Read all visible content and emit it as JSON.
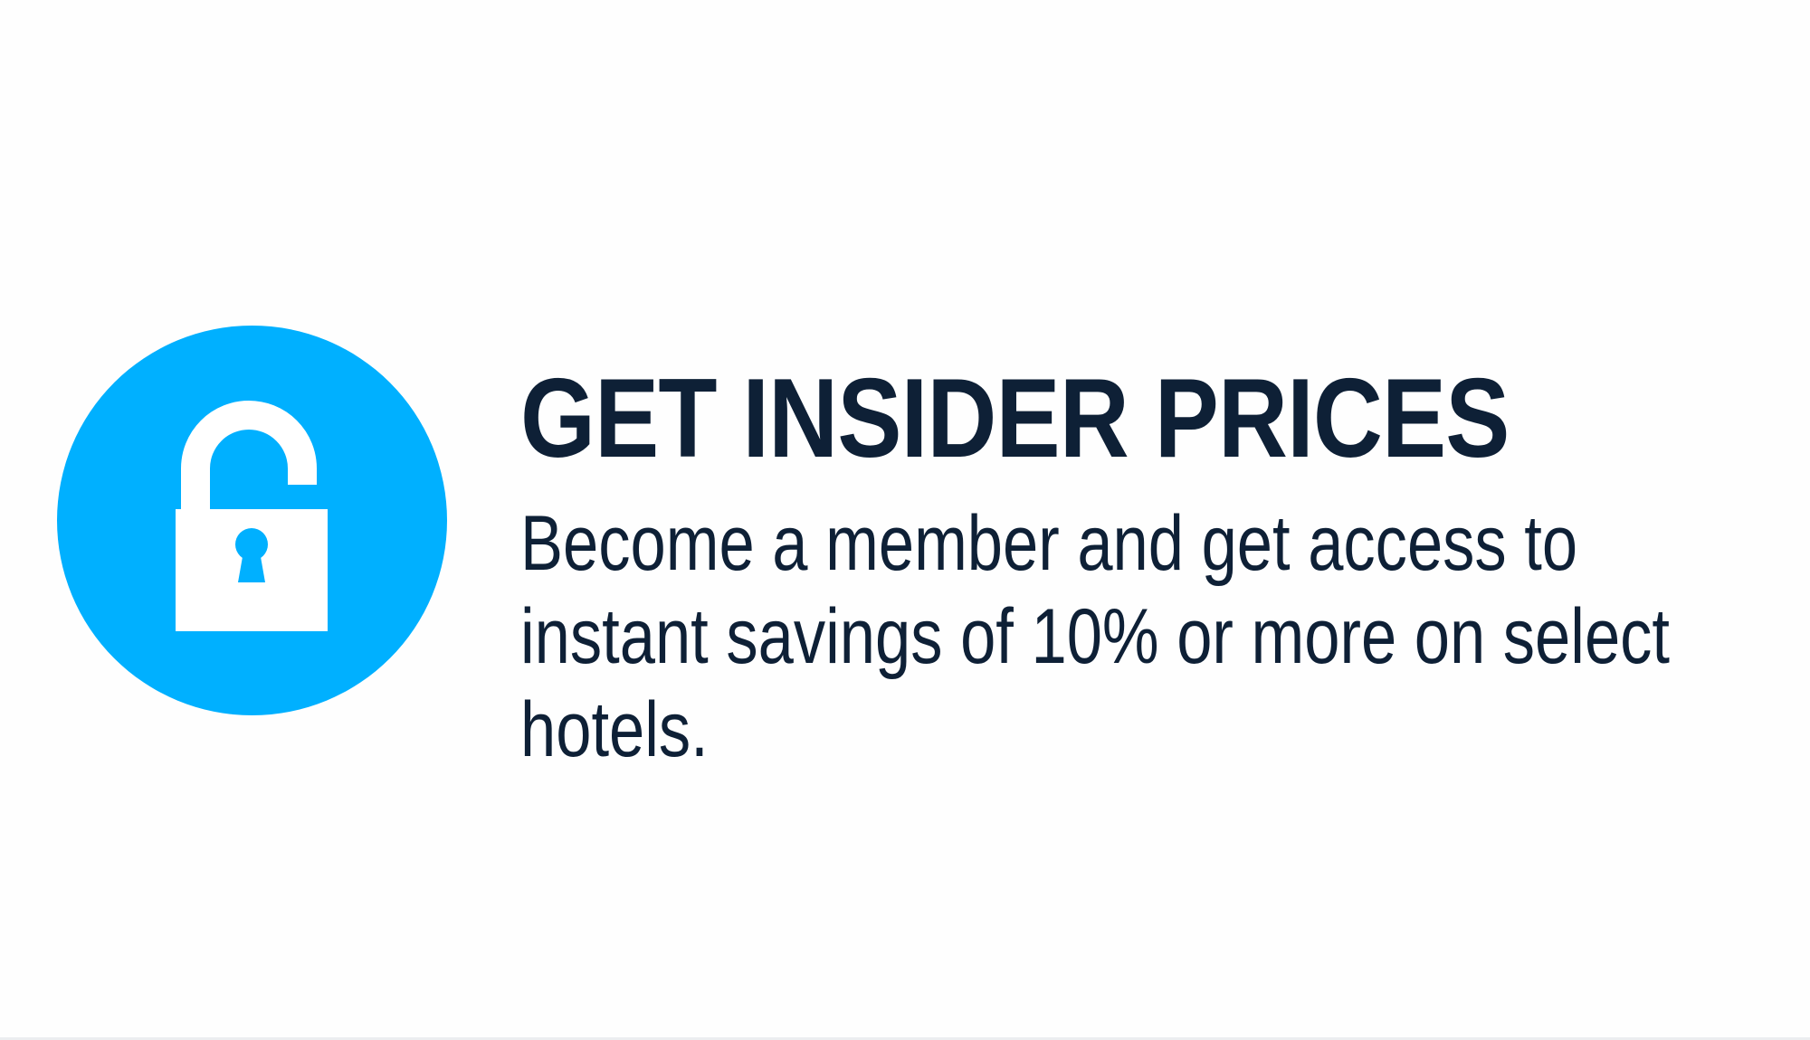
{
  "promo": {
    "headline": "GET INSIDER PRICES",
    "body": "Become a member and get access to instant savings of 10% or more on select hotels.",
    "icon": "unlocked-padlock-icon"
  },
  "colors": {
    "accent": "#00b0ff",
    "text": "#0e2036",
    "background": "#fefefe"
  }
}
